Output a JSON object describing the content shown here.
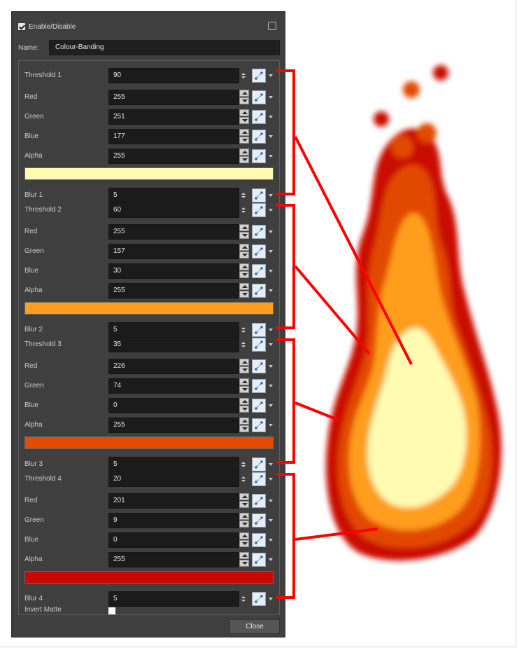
{
  "dialog": {
    "enable_label": "Enable/Disable",
    "name_label": "Name:",
    "name_value": "Colour-Banding",
    "close_label": "Close",
    "invert_matte_label": "Invert Matte"
  },
  "bands": [
    {
      "threshold_label": "Threshold 1",
      "threshold": "90",
      "red_label": "Red",
      "red": "255",
      "green_label": "Green",
      "green": "251",
      "blue_label": "Blue",
      "blue": "177",
      "alpha_label": "Alpha",
      "alpha": "255",
      "swatch_color": "#fffbb1",
      "blur_label": "Blur 1",
      "blur": "5"
    },
    {
      "threshold_label": "Threshold 2",
      "threshold": "60",
      "red_label": "Red",
      "red": "255",
      "green_label": "Green",
      "green": "157",
      "blue_label": "Blue",
      "blue": "30",
      "alpha_label": "Alpha",
      "alpha": "255",
      "swatch_color": "#ff9d1e",
      "blur_label": "Blur 2",
      "blur": "5"
    },
    {
      "threshold_label": "Threshold 3",
      "threshold": "35",
      "red_label": "Red",
      "red": "226",
      "green_label": "Green",
      "green": "74",
      "blue_label": "Blue",
      "blue": "0",
      "alpha_label": "Alpha",
      "alpha": "255",
      "swatch_color": "#e24a00",
      "blur_label": "Blur 3",
      "blur": "5"
    },
    {
      "threshold_label": "Threshold 4",
      "threshold": "20",
      "red_label": "Red",
      "red": "201",
      "green_label": "Green",
      "green": "9",
      "blue_label": "Blue",
      "blue": "0",
      "alpha_label": "Alpha",
      "alpha": "255",
      "swatch_color": "#c90900",
      "blur_label": "Blur 4",
      "blur": "5"
    }
  ],
  "annotation_color": "#ff0000",
  "flame_colors": [
    "#c90900",
    "#e24a00",
    "#ff9d1e",
    "#fffbb1"
  ]
}
